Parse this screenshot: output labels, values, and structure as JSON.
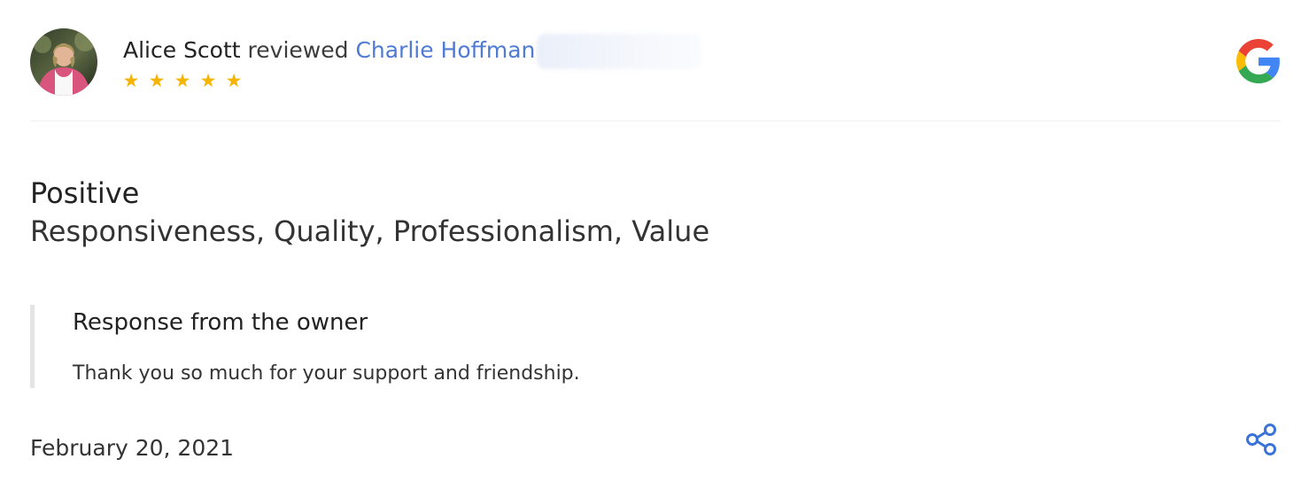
{
  "review": {
    "reviewer_name": "Alice Scott",
    "verb": "reviewed",
    "business_name": "Charlie Hoffman",
    "rating": 5,
    "rating_stars": [
      "★",
      "★",
      "★",
      "★",
      "★"
    ],
    "sentiment": "Positive",
    "attributes": "Responsiveness, Quality, Professionalism, Value",
    "date": "February 20, 2021"
  },
  "owner_response": {
    "title": "Response from the owner",
    "text": "Thank you so much for your support and friendship."
  },
  "icons": {
    "source": "google-logo",
    "share": "share-icon",
    "star": "star-icon"
  },
  "colors": {
    "link": "#4f7bd4",
    "star": "#f4b400",
    "share": "#3b73d9",
    "google_blue": "#4285f4",
    "google_red": "#ea4335",
    "google_yellow": "#fbbc05",
    "google_green": "#34a853"
  }
}
